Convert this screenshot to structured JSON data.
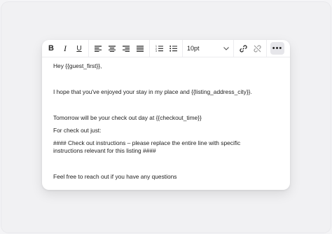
{
  "toolbar": {
    "bold_glyph": "B",
    "italic_glyph": "I",
    "underline_glyph": "U",
    "font_size": "10pt",
    "more_glyph": "•••",
    "icons": [
      "bold-icon",
      "italic-icon",
      "underline-icon",
      "align-left-icon",
      "align-center-icon",
      "align-right-icon",
      "align-justify-icon",
      "ordered-list-icon",
      "bullet-list-icon",
      "chevron-down-icon",
      "link-icon",
      "unlink-icon",
      "more-icon"
    ]
  },
  "content": {
    "greeting": "Hey {{guest_first}},",
    "line1": "I hope that you've enjoyed your stay in my place and {{listing_address_city}}.",
    "line2": "Tomorrow will be your check out day at {{checkout_time}}",
    "line3": "For check out just:",
    "line4": "#### Check out instructions – please replace the entire line with specific instructions relevant for this listing ####",
    "line5": "Feel free to reach out if you have any questions"
  }
}
